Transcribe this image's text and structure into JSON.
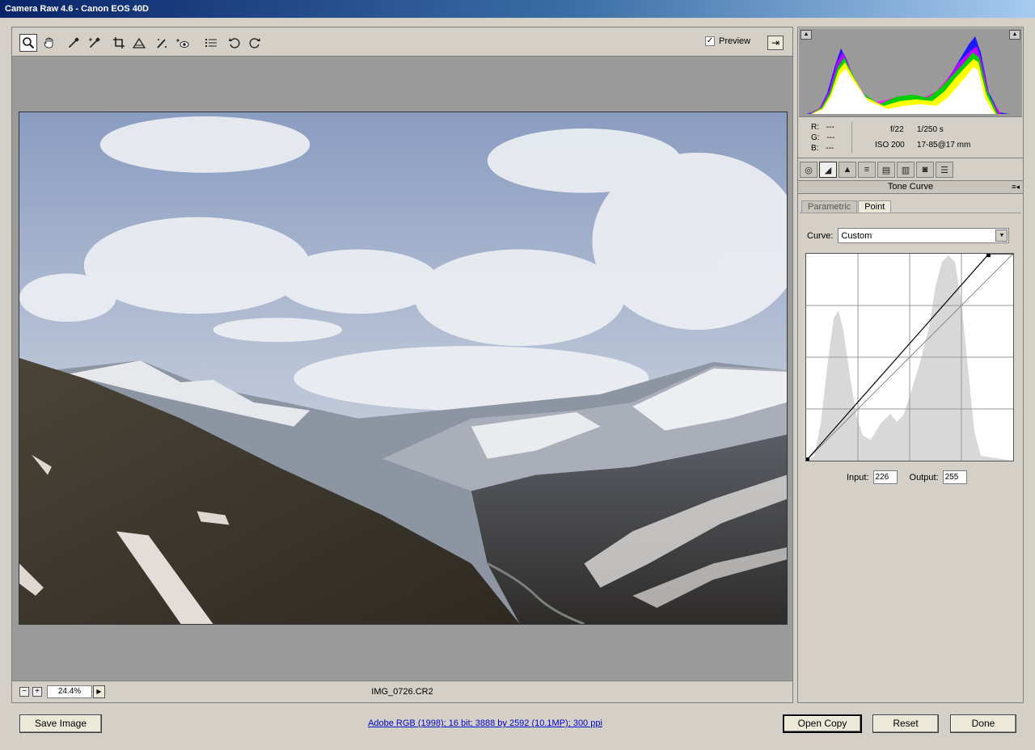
{
  "window": {
    "title": "Camera Raw 4.6  -  Canon EOS 40D"
  },
  "toolbar": {
    "tools": [
      {
        "name": "zoom-tool",
        "icon": "magnifier-icon",
        "active": true
      },
      {
        "name": "hand-tool",
        "icon": "hand-icon"
      },
      {
        "name": "white-balance-tool",
        "icon": "eyedropper-icon"
      },
      {
        "name": "color-sampler-tool",
        "icon": "color-sampler-icon"
      },
      {
        "name": "crop-tool",
        "icon": "crop-icon"
      },
      {
        "name": "straighten-tool",
        "icon": "straighten-icon"
      },
      {
        "name": "retouch-tool",
        "icon": "retouch-icon"
      },
      {
        "name": "red-eye-tool",
        "icon": "red-eye-icon"
      },
      {
        "name": "preferences-tool",
        "icon": "list-icon"
      },
      {
        "name": "rotate-ccw-tool",
        "icon": "rotate-left-icon"
      },
      {
        "name": "rotate-cw-tool",
        "icon": "rotate-right-icon"
      }
    ],
    "preview_label": "Preview",
    "preview_checked": true
  },
  "status": {
    "zoom_value": "24.4%",
    "filename": "IMG_0726.CR2"
  },
  "info": {
    "r_label": "R:",
    "r_value": "---",
    "g_label": "G:",
    "g_value": "---",
    "b_label": "B:",
    "b_value": "---",
    "aperture": "f/22",
    "shutter": "1/250 s",
    "iso": "ISO 200",
    "lens": "17-85@17 mm"
  },
  "panel": {
    "title": "Tone Curve",
    "subtabs": [
      "Parametric",
      "Point"
    ],
    "active_subtab": "Point",
    "curve_label": "Curve:",
    "curve_value": "Custom",
    "input_label": "Input:",
    "input_value": "226",
    "output_label": "Output:",
    "output_value": "255"
  },
  "buttons": {
    "save_image": "Save Image",
    "open_copy": "Open Copy",
    "reset": "Reset",
    "done": "Done"
  },
  "workflow_link": "Adobe RGB (1998); 16 bit; 3888 by 2592 (10.1MP); 300 ppi"
}
